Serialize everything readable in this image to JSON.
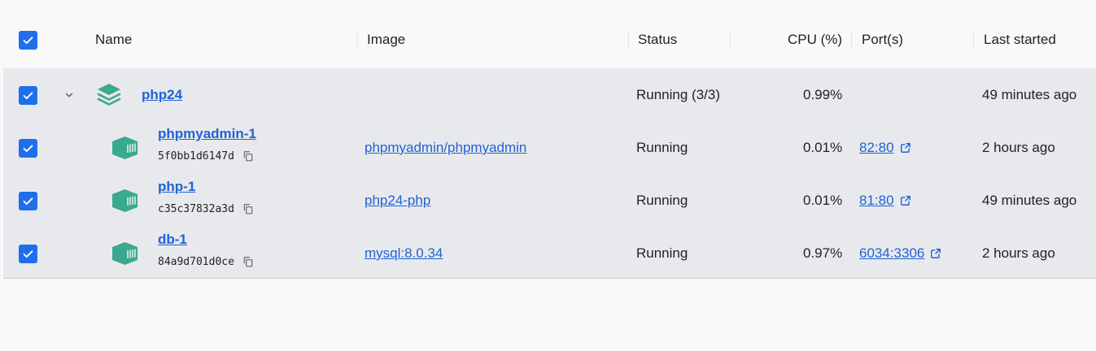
{
  "header": {
    "name": "Name",
    "image": "Image",
    "status": "Status",
    "cpu": "CPU (%)",
    "ports": "Port(s)",
    "last_started": "Last started"
  },
  "group": {
    "name": "php24",
    "status": "Running (3/3)",
    "cpu": "0.99%",
    "last_started": "49 minutes ago",
    "icon": "stack-layers-icon"
  },
  "containers": [
    {
      "name": "phpmyadmin-1",
      "id": "5f0bb1d6147d",
      "image": "phpmyadmin/phpmyadmin",
      "status": "Running",
      "cpu": "0.01%",
      "port": "82:80",
      "last_started": "2 hours ago"
    },
    {
      "name": "php-1",
      "id": "c35c37832a3d",
      "image": "php24-php",
      "status": "Running",
      "cpu": "0.01%",
      "port": "81:80",
      "last_started": "49 minutes ago"
    },
    {
      "name": "db-1",
      "id": "84a9d701d0ce",
      "image": "mysql:8.0.34",
      "status": "Running",
      "cpu": "0.97%",
      "port": "6034:3306",
      "last_started": "2 hours ago"
    }
  ],
  "colors": {
    "checkbox": "#1f6feb",
    "link": "#1f62d6",
    "container_icon": "#3aa98f",
    "row_bg": "#e8e9ec"
  }
}
